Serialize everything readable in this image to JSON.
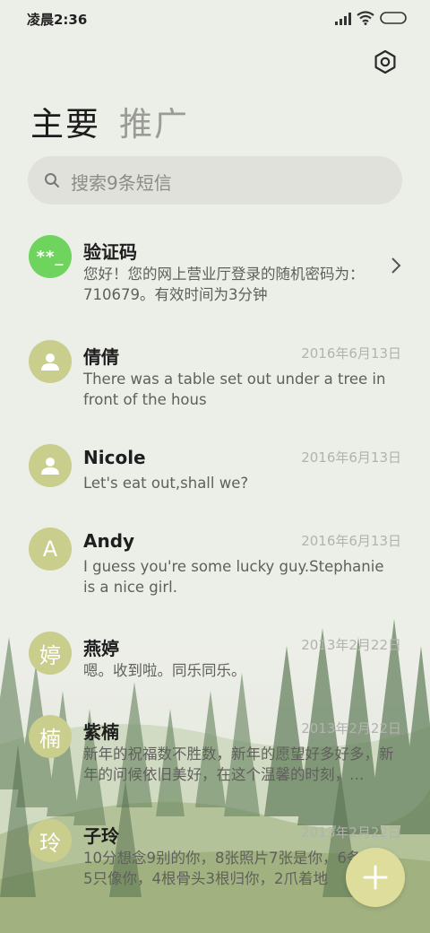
{
  "status_bar": {
    "time": "凌晨2:36"
  },
  "tabs": [
    {
      "label": "主要",
      "active": true
    },
    {
      "label": "推广",
      "active": false
    }
  ],
  "search": {
    "placeholder": "搜索9条短信"
  },
  "conversations": [
    {
      "avatar": "**_",
      "avatar_color": "#6fd45d",
      "name": "验证码",
      "date": "",
      "preview": "您好！您的网上营业厅登录的随机密码为：710679。有效时间为3分钟"
    },
    {
      "avatar_icon": "person-icon",
      "avatar_color": "#c9ce8c",
      "name": "倩倩",
      "date": "2016年6月13日",
      "preview": "There was a table set out under a tree in front of the hous"
    },
    {
      "avatar_icon": "person-icon",
      "avatar_color": "#c9ce8c",
      "name": "Nicole",
      "date": "2016年6月13日",
      "preview": "Let's eat out,shall we?"
    },
    {
      "avatar": "A",
      "avatar_color": "#c9ce8c",
      "name": "Andy",
      "date": "2016年6月13日",
      "preview": "I guess you're some lucky guy.Stephanie is a nice girl."
    },
    {
      "avatar": "婷",
      "avatar_color": "#c9ce8c",
      "name": "燕婷",
      "date": "2013年2月22日",
      "preview": "嗯。收到啦。同乐同乐。"
    },
    {
      "avatar": "楠",
      "avatar_color": "#c9ce8c",
      "name": "紫楠",
      "date": "2013年2月22日",
      "preview": "新年的祝福数不胜数，新年的愿望好多好多，新年的问候依旧美好，在这个温馨的时刻，…"
    },
    {
      "avatar": "玲",
      "avatar_color": "#c9ce8c",
      "name": "子玲",
      "date": "2013年2月22日",
      "preview": "10分想念9别的你，8张照片7张是你，6条小狗5只像你，4根骨头3根归你，2爪着地"
    }
  ],
  "icons": {
    "settings": "settings-icon",
    "search": "search-icon",
    "compose": "plus-icon",
    "chevron": "chevron-right-icon"
  },
  "colors": {
    "background": "#eceee8",
    "avatar": "#c9ce8c",
    "avatar_code": "#6fd45d",
    "fab": "#dedd9c"
  }
}
